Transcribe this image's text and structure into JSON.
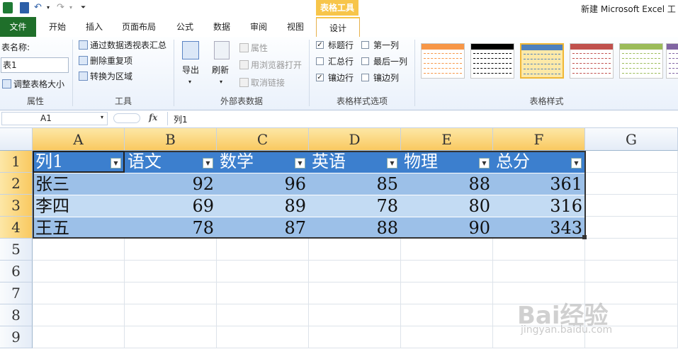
{
  "title_bar": {
    "context_tab_group": "表格工具",
    "app_title": "新建 Microsoft Excel 工"
  },
  "tabs": [
    "文件",
    "开始",
    "插入",
    "页面布局",
    "公式",
    "数据",
    "审阅",
    "视图",
    "设计"
  ],
  "ribbon": {
    "properties": {
      "table_name_label": "表名称:",
      "table_name_value": "表1",
      "resize_label": "调整表格大小",
      "group_label": "属性"
    },
    "tools": {
      "pivot_label": "通过数据透视表汇总",
      "remove_dup_label": "删除重复项",
      "convert_label": "转换为区域",
      "group_label": "工具"
    },
    "external": {
      "export_label": "导出",
      "refresh_label": "刷新",
      "properties_label": "属性",
      "browser_label": "用浏览器打开",
      "unlink_label": "取消链接",
      "group_label": "外部表数据"
    },
    "style_options": {
      "header_row": {
        "label": "标题行",
        "checked": true
      },
      "total_row": {
        "label": "汇总行",
        "checked": false
      },
      "banded_rows": {
        "label": "镶边行",
        "checked": true
      },
      "first_column": {
        "label": "第一列",
        "checked": false
      },
      "last_column": {
        "label": "最后一列",
        "checked": false
      },
      "banded_columns": {
        "label": "镶边列",
        "checked": false
      },
      "group_label": "表格样式选项"
    },
    "table_styles": {
      "group_label": "表格样式",
      "thumbs": [
        {
          "header": "#f79646",
          "line": "#f79646"
        },
        {
          "header": "#000000",
          "line": "#000000"
        },
        {
          "header": "#4f81bd",
          "line": "#4f81bd"
        },
        {
          "header": "#c0504d",
          "line": "#c0504d"
        },
        {
          "header": "#9bbb59",
          "line": "#9bbb59"
        },
        {
          "header": "#8064a2",
          "line": "#8064a2"
        }
      ]
    }
  },
  "formula_bar": {
    "name_box": "A1",
    "fx": "fx",
    "formula": "列1"
  },
  "sheet": {
    "columns": [
      "A",
      "B",
      "C",
      "D",
      "E",
      "F",
      "G"
    ],
    "rows": [
      "1",
      "2",
      "3",
      "4",
      "5",
      "6",
      "7",
      "8",
      "9"
    ],
    "headers": [
      "列1",
      "语文",
      "数学",
      "英语",
      "物理",
      "总分"
    ],
    "data": [
      [
        "张三",
        "92",
        "96",
        "85",
        "88",
        "361"
      ],
      [
        "李四",
        "69",
        "89",
        "78",
        "80",
        "316"
      ],
      [
        "王五",
        "78",
        "87",
        "88",
        "90",
        "343"
      ]
    ]
  },
  "watermark": {
    "line1": "Bai经验",
    "line2": "jingyan.baidu.com"
  },
  "colors": {
    "header_fill": "#3c7fce",
    "band_dark": "#9cc0e8",
    "band_light": "#c3dbf3",
    "file_tab": "#1f6f2a",
    "context_tab": "#f7c54a"
  }
}
